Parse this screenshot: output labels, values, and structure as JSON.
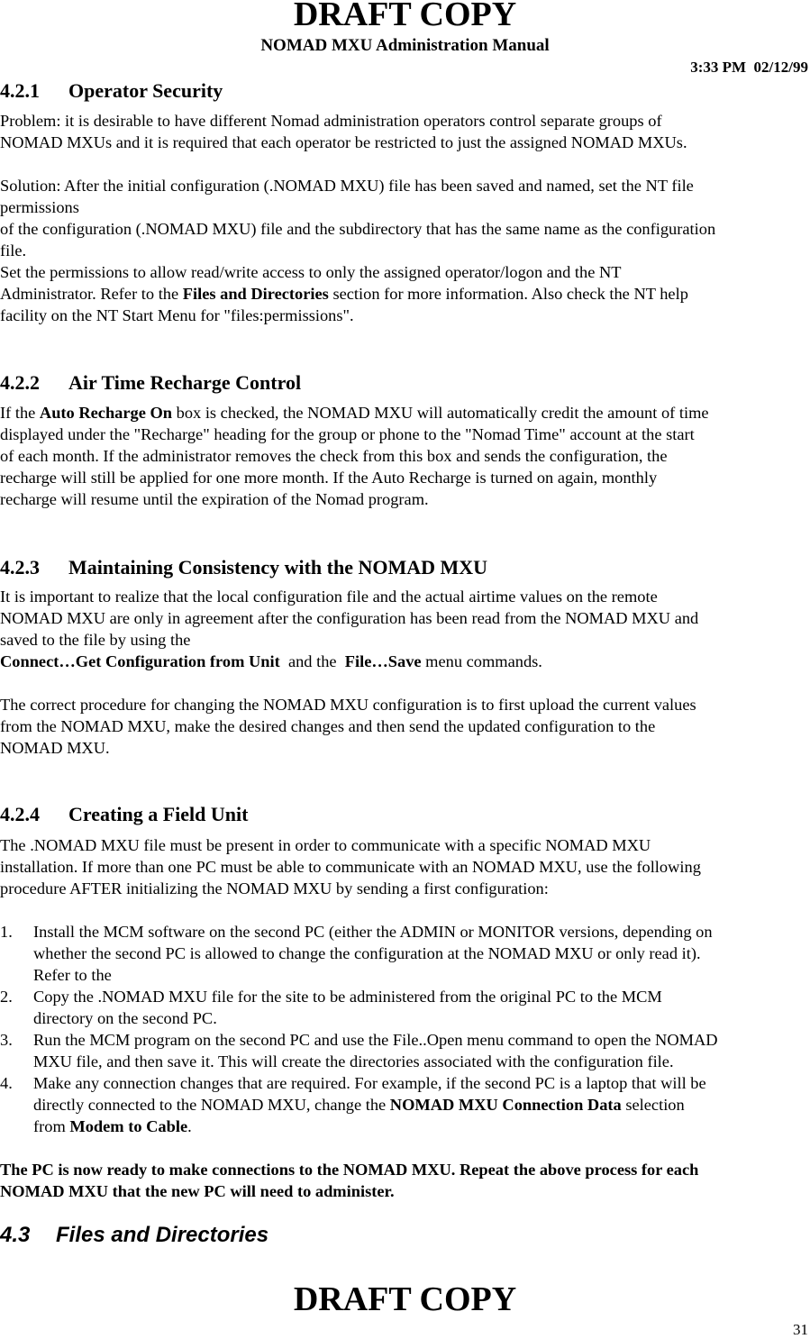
{
  "header": {
    "draft_label": "DRAFT COPY",
    "manual_title": "NOMAD MXU Administration Manual",
    "time": "3:33 PM",
    "date": "02/12/99"
  },
  "sections": {
    "s421": {
      "number": "4.2.1",
      "title": "Operator Security",
      "lines": [
        "Problem: it is desirable to have different Nomad administration operators control separate groups of",
        "NOMAD MXUs and it is required that each operator be restricted to just the assigned NOMAD MXUs.",
        "Solution:  After the initial configuration (.NOMAD MXU) file has been saved and named,  set the NT file",
        "permissions",
        "of the configuration (.NOMAD MXU) file and the subdirectory that has the same name as the configuration",
        "file.",
        "Set the permissions to allow read/write access to only the assigned operator/logon and the NT",
        "Administrator. Refer to the ",
        "Files and Directories",
        " section for more information.  Also check the NT help",
        "facility on the NT Start Menu for \"files:permissions\"."
      ]
    },
    "s422": {
      "number": "4.2.2",
      "title": "Air Time Recharge Control",
      "lines": [
        "If the ",
        "Auto Recharge On",
        " box is checked,  the NOMAD MXU will automatically credit the amount of time",
        "displayed under the \"Recharge\"  heading for the group or phone to the \"Nomad Time\" account at the start",
        "of each month.  If the administrator removes the check from this box and sends the configuration, the",
        "recharge will still be applied for one more month.   If the Auto Recharge is turned on again, monthly",
        "recharge will resume until the expiration of the Nomad program."
      ]
    },
    "s423": {
      "number": "4.2.3",
      "title": "Maintaining Consistency with the NOMAD MXU",
      "lines": [
        "It is important to realize that the local configuration file and the actual airtime values on the remote",
        "NOMAD MXU are only in agreement after the configuration has been read from the NOMAD MXU and",
        "saved to the file by using the",
        "Connect…Get Configuration from Unit",
        "  and the  ",
        "File…Save",
        " menu commands.",
        "The correct procedure for changing the NOMAD MXU configuration is to first upload the current values",
        "from the NOMAD MXU, make the desired changes and then send the updated configuration to the",
        "NOMAD MXU."
      ]
    },
    "s424": {
      "number": "4.2.4",
      "title": "Creating a Field Unit",
      "lines": [
        "The .NOMAD MXU file must be present in order to communicate with a specific NOMAD MXU",
        "installation.  If more than one PC must be able to communicate with an NOMAD MXU, use the following",
        "procedure AFTER initializing the NOMAD MXU by sending a first configuration:"
      ],
      "list": [
        {
          "num": "1.",
          "lines": [
            "Install the MCM software on the second PC (either the ADMIN or MONITOR versions, depending on",
            "whether the second PC is allowed to change the configuration at the NOMAD MXU or only read it).",
            "Refer to the"
          ]
        },
        {
          "num": "2.",
          "lines": [
            "Copy the .NOMAD MXU file for the site to be administered from the original PC to the MCM",
            "directory on the second PC."
          ]
        },
        {
          "num": "3.",
          "lines": [
            "Run the MCM program on the second PC and use the File..Open menu command to open the NOMAD",
            "MXU file, and then save it.  This will create the directories associated with the configuration file."
          ]
        },
        {
          "num": "4.",
          "lines": [
            "Make any connection changes that are required.  For example, if the second PC is a laptop that will be",
            "directly connected to the NOMAD MXU, change the ",
            "NOMAD MXU Connection Data",
            " selection",
            "from ",
            "Modem to Cable",
            "."
          ]
        }
      ],
      "closing": [
        "The PC is now ready to make connections to the NOMAD MXU.  Repeat the above process for each",
        "NOMAD MXU that the new PC will need to administer."
      ]
    },
    "s43": {
      "number": "4.3",
      "title": "Files and Directories"
    }
  },
  "footer": {
    "draft_label": "DRAFT COPY",
    "page_number": "31"
  }
}
